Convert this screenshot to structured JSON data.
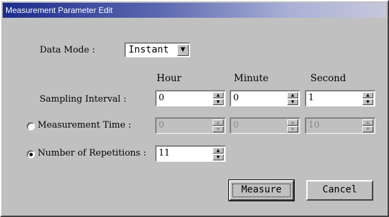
{
  "window": {
    "title": "Measurement Parameter Edit"
  },
  "data_mode": {
    "label": "Data Mode :",
    "value": "Instant"
  },
  "columns": {
    "hour": "Hour",
    "minute": "Minute",
    "second": "Second"
  },
  "sampling_interval": {
    "label": "Sampling Interval :",
    "hour": "0",
    "minute": "0",
    "second": "1"
  },
  "measurement_time": {
    "label": "Measurement Time :",
    "hour": "0",
    "minute": "0",
    "second": "10",
    "selected": false
  },
  "repetitions": {
    "label": "Number of Repetitions :",
    "value": "11",
    "selected": true
  },
  "buttons": {
    "measure": "Measure",
    "cancel": "Cancel"
  },
  "icons": {
    "dropdown": "chevron-down-icon",
    "spin_up": "spin-up-icon",
    "spin_down": "spin-down-icon"
  },
  "colors": {
    "title_start": "#1c2c8c",
    "title_end": "#c6c8dc",
    "face": "#c0c0c0"
  }
}
